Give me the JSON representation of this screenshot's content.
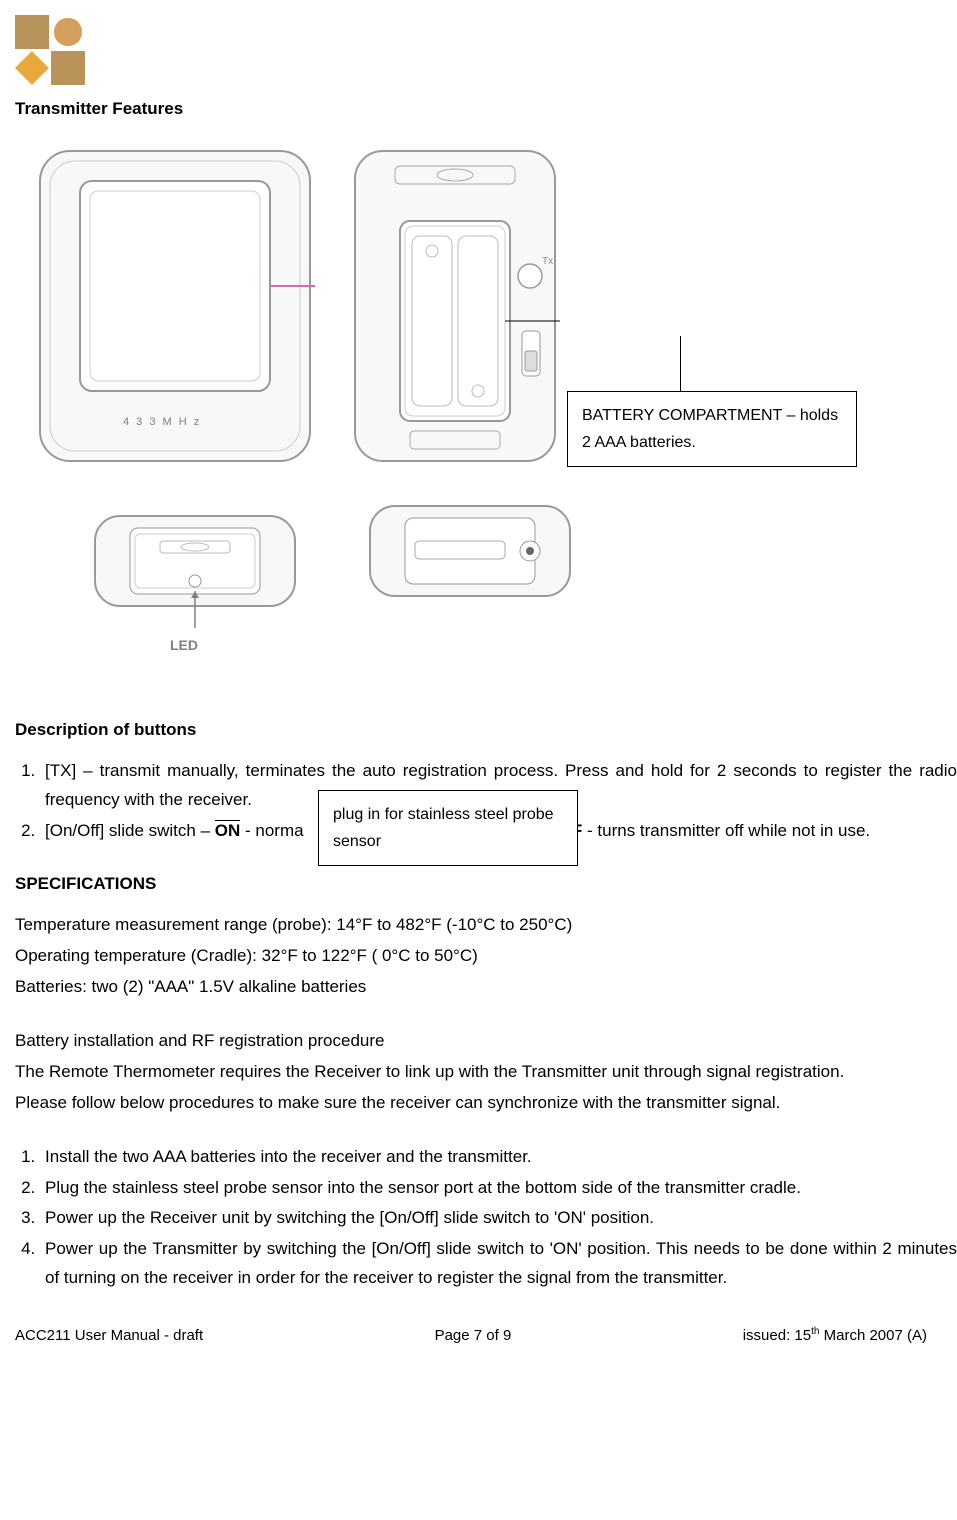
{
  "header": {
    "title": "Transmitter Features"
  },
  "figure": {
    "mhz_text": "4 3 3 M H z",
    "led_text": "LED"
  },
  "callouts": {
    "battery": "BATTERY COMPARTMENT – holds 2 AAA batteries.",
    "probe": "plug in for stainless steel probe sensor"
  },
  "desc_buttons": {
    "heading": "Description of buttons",
    "item1": "[TX] – transmit manually, terminates the auto registration process. Press and hold for 2 seconds to register the radio frequency with the receiver.",
    "item2_pre": "[On/Off] slide switch – ",
    "item2_on": "ON",
    "item2_mid": " - norma",
    "item2_off": "OFF",
    "item2_end": " - turns transmitter off while not in use."
  },
  "specs": {
    "heading": "SPECIFICATIONS",
    "line1": "Temperature measurement range (probe): 14°F to 482°F (-10°C to 250°C)",
    "line2": "Operating temperature (Cradle): 32°F to 122°F ( 0°C to 50°C)",
    "line3": "Batteries: two (2) \"AAA\"  1.5V alkaline batteries"
  },
  "procedure": {
    "heading": "Battery installation and RF registration procedure",
    "intro1": "The Remote Thermometer requires the Receiver to link up with the Transmitter unit through signal registration.",
    "intro2": "Please follow below procedures to make sure the receiver can synchronize with the transmitter signal.",
    "step1": "Install the two AAA batteries into the receiver and the transmitter.",
    "step2": "Plug the stainless steel probe sensor into the sensor port at the bottom side of the transmitter cradle.",
    "step3": "Power up the Receiver unit by switching the [On/Off] slide switch to 'ON' position.",
    "step4": "Power up the Transmitter by switching the [On/Off] slide switch to 'ON' position. This needs to be done within 2 minutes of turning on the receiver in order for the receiver to register the signal from the transmitter."
  },
  "footer": {
    "left": "ACC211 User Manual - draft",
    "center": "Page 7 of 9",
    "right_pre": "issued: 15",
    "right_sup": "th",
    "right_post": " March 2007 (A)"
  }
}
